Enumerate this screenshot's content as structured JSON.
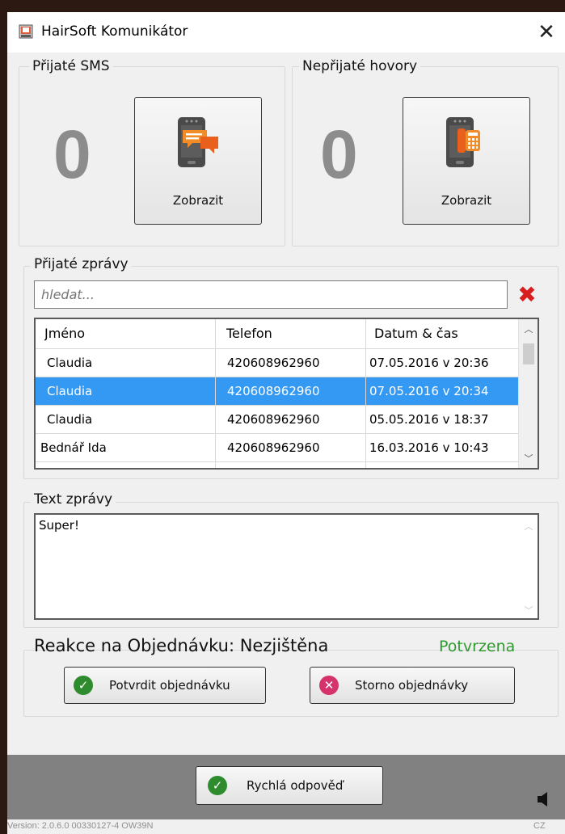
{
  "window": {
    "title": "HairSoft Komunikátor",
    "close_icon": "close-icon"
  },
  "sms_panel": {
    "label": "Přijaté SMS",
    "count": "0",
    "button_label": "Zobrazit",
    "icon": "sms-phone-icon"
  },
  "calls_panel": {
    "label": "Nepřijaté hovory",
    "count": "0",
    "button_label": "Zobrazit",
    "icon": "missed-call-phone-icon"
  },
  "messages": {
    "label": "Přijaté zprávy",
    "search_placeholder": "hledat...",
    "columns": [
      "Jméno",
      "Telefon",
      "Datum & čas"
    ],
    "rows": [
      {
        "name": "Claudia",
        "phone": "420608962960",
        "datetime": "07.05.2016 v 20:36",
        "selected": false
      },
      {
        "name": "Claudia",
        "phone": "420608962960",
        "datetime": "07.05.2016 v 20:34",
        "selected": true
      },
      {
        "name": "Claudia",
        "phone": "420608962960",
        "datetime": "05.05.2016 v 18:37",
        "selected": false
      },
      {
        "name": "Bednář Ida",
        "phone": "420608962960",
        "datetime": "16.03.2016 v 10:43",
        "selected": false
      }
    ]
  },
  "message_text": {
    "label": "Text zprávy",
    "value": "Super!"
  },
  "reaction": {
    "label": "Reakce na Objednávku: Nezjištěna",
    "status": "Potvrzena",
    "status_color": "#2e9a2e",
    "confirm_label": "Potvrdit objednávku",
    "cancel_label": "Storno objednávky"
  },
  "quick_reply": {
    "label": "Rychlá odpověď"
  },
  "status": {
    "version": "Version: 2.0.6.0 00330127-4 OW39N",
    "language": "CZ"
  },
  "colors": {
    "selection": "#3399f3",
    "confirm_icon": "#2e8b2e",
    "cancel_icon": "#d6336c",
    "bottom_bar": "#818181"
  }
}
